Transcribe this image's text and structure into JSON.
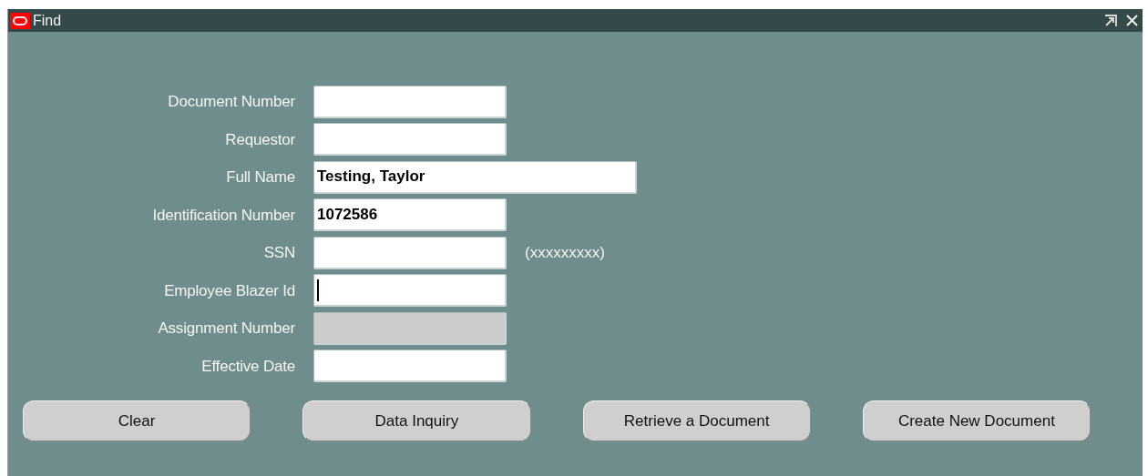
{
  "window": {
    "title": "Find"
  },
  "fields": [
    {
      "label": "Document Number",
      "kind": "short",
      "disabled": false,
      "focused": false
    },
    {
      "label": "Requestor",
      "kind": "short",
      "disabled": false,
      "focused": false
    },
    {
      "label": "Full Name",
      "kind": "long",
      "value": "Testing, Taylor",
      "disabled": false,
      "focused": false
    },
    {
      "label": "Identification Number",
      "kind": "short",
      "value": "1072586",
      "disabled": false,
      "focused": false
    },
    {
      "label": "SSN",
      "kind": "short",
      "disabled": false,
      "focused": false,
      "hint": "(xxxxxxxxx)"
    },
    {
      "label": "Employee Blazer Id",
      "kind": "short",
      "disabled": false,
      "focused": true
    },
    {
      "label": "Assignment Number",
      "kind": "short",
      "disabled": true,
      "focused": false
    },
    {
      "label": "Effective Date",
      "kind": "short",
      "disabled": false,
      "focused": false
    }
  ],
  "buttons": [
    "Clear",
    "Data Inquiry",
    "Retrieve a Document",
    "Create New Document"
  ]
}
